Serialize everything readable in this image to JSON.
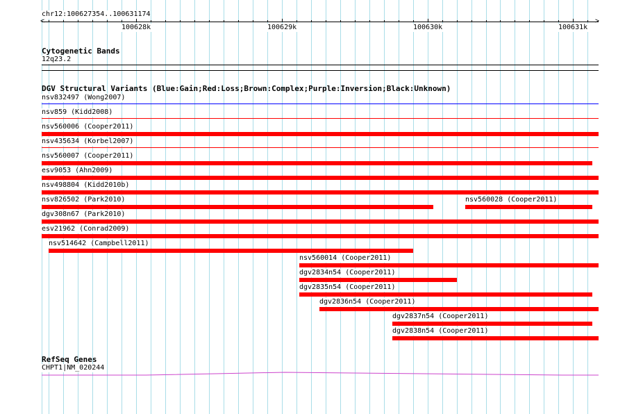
{
  "ruler": {
    "position_label": "chr12:100627354..100631174",
    "range": [
      100627354,
      100631174
    ],
    "major_ticks": [
      {
        "value": 100628000,
        "label": "100628k"
      },
      {
        "value": 100629000,
        "label": "100629k"
      },
      {
        "value": 100630000,
        "label": "100630k"
      },
      {
        "value": 100631000,
        "label": "100631k"
      }
    ]
  },
  "cytobands": {
    "title": "Cytogenetic Bands",
    "band": "12q23.2"
  },
  "dgv": {
    "title": "DGV Structural Variants (Blue:Gain;Red:Loss;Brown:Complex;Purple:Inversion;Black:Unknown)",
    "colors": {
      "gain": "#0000ff",
      "loss": "#ff0000"
    },
    "features": [
      {
        "label": "nsv832497 (Wong2007)",
        "type": "gain",
        "start": 100627354,
        "end": 100631174,
        "thin": true
      },
      {
        "label": "nsv859 (Kidd2008)",
        "type": "loss",
        "start": 100627354,
        "end": 100631174,
        "thin": true
      },
      {
        "label": "nsv560006 (Cooper2011)",
        "type": "loss",
        "start": 100627354,
        "end": 100631174
      },
      {
        "label": "nsv435634 (Korbel2007)",
        "type": "loss",
        "start": 100627354,
        "end": 100631174,
        "thin": true
      },
      {
        "label": "nsv560007 (Cooper2011)",
        "type": "loss",
        "start": 100627354,
        "end": 100631130
      },
      {
        "label": "esv9053 (Ahn2009)",
        "type": "loss",
        "start": 100627354,
        "end": 100631174
      },
      {
        "label": "nsv498804 (Kidd2010b)",
        "type": "loss",
        "start": 100627354,
        "end": 100631174
      },
      {
        "label": "nsv826502 (Park2010)",
        "type": "loss",
        "start": 100627354,
        "end": 100630040
      },
      {
        "label": "nsv560028 (Cooper2011)",
        "type": "loss",
        "start": 100630260,
        "end": 100631130
      },
      {
        "label": "dgv308n67 (Park2010)",
        "type": "loss",
        "start": 100627354,
        "end": 100631174
      },
      {
        "label": "esv21962 (Conrad2009)",
        "type": "loss",
        "start": 100627354,
        "end": 100631174
      },
      {
        "label": "nsv514642 (Campbell2011)",
        "type": "loss",
        "start": 100627400,
        "end": 100629900
      },
      {
        "label": "nsv560014 (Cooper2011)",
        "type": "loss",
        "start": 100629120,
        "end": 100631174
      },
      {
        "label": "dgv2834n54 (Cooper2011)",
        "type": "loss",
        "start": 100629120,
        "end": 100630200
      },
      {
        "label": "dgv2835n54 (Cooper2011)",
        "type": "loss",
        "start": 100629120,
        "end": 100631130
      },
      {
        "label": "dgv2836n54 (Cooper2011)",
        "type": "loss",
        "start": 100629260,
        "end": 100631174
      },
      {
        "label": "dgv2837n54 (Cooper2011)",
        "type": "loss",
        "start": 100629760,
        "end": 100631130
      },
      {
        "label": "dgv2838n54 (Cooper2011)",
        "type": "loss",
        "start": 100629760,
        "end": 100631174
      }
    ]
  },
  "refseq": {
    "title": "RefSeq Genes",
    "gene_label": "CHPT1|NM_020244",
    "color": "#cc44cc"
  }
}
